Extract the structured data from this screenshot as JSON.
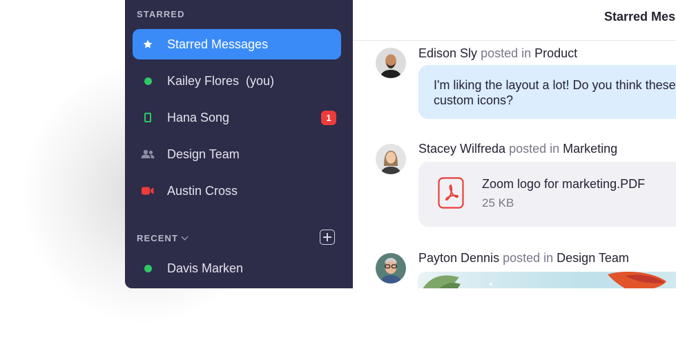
{
  "sidebar": {
    "starred_heading": "STARRED",
    "recent_heading": "RECENT",
    "items": [
      {
        "label": "Starred Messages",
        "icon": "star-icon",
        "active": true
      },
      {
        "label": "Kailey Flores  (you)",
        "icon": "online-dot-icon"
      },
      {
        "label": "Hana Song",
        "icon": "mobile-phone-icon",
        "badge": "1"
      },
      {
        "label": "Design Team",
        "icon": "people-icon"
      },
      {
        "label": "Austin Cross",
        "icon": "video-camera-icon"
      }
    ],
    "recent_items": [
      {
        "label": "Davis Marken",
        "icon": "online-dot-icon"
      }
    ]
  },
  "header": {
    "title": "Starred Messages"
  },
  "posts": [
    {
      "author": "Edison Sly",
      "posted_in": "posted in",
      "channel": "Product",
      "message": "I'm liking the layout a lot! Do you think these custom icons?"
    },
    {
      "author": "Stacey Wilfreda",
      "posted_in": "posted in",
      "channel": "Marketing",
      "file_name": "Zoom logo for marketing.PDF",
      "file_size": "25 KB"
    },
    {
      "author": "Payton Dennis",
      "posted_in": "posted in",
      "channel": "Design Team"
    }
  ],
  "colors": {
    "sidebar_bg": "#2d2c49",
    "active_item": "#3a8bf7",
    "online": "#2fc865",
    "badge": "#ee3b3b",
    "bubble": "#dcedfd",
    "pdf_icon": "#e8403a"
  }
}
